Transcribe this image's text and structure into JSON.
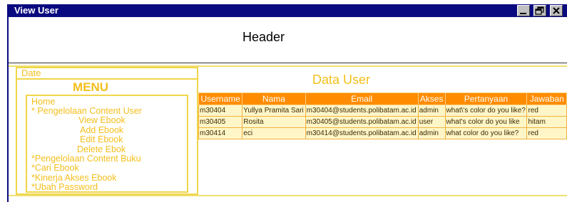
{
  "window": {
    "title": "View User"
  },
  "header": {
    "text": "Header"
  },
  "sidebar": {
    "date_label": "Date",
    "menu_title": "MENU",
    "items": [
      "Home",
      "* Pengelolaan Content User",
      "View Ebook",
      "Add Ebook",
      "Edit Ebook",
      "Delete Ebok",
      "*Pengelolaan Content Buku",
      "*Cari Ebook",
      "*Kinerja Akses Ebook",
      "*Ubah Password"
    ]
  },
  "main": {
    "title": "Data User",
    "columns": [
      "Username",
      "Nama",
      "Email",
      "Akses",
      "Pertanyaan",
      "Jawaban"
    ],
    "rows": [
      [
        "m30404",
        "Yullya Pramita Sari",
        "m30404@students.polibatam.ac.id",
        "admin",
        "what\\'s color do you like?",
        "red"
      ],
      [
        "m30405",
        "Rosita",
        "m30405@students.polibatam.ac.id",
        "user",
        "what's color do you like",
        "hitam"
      ],
      [
        "m30414",
        "eci",
        "m30414@students.polibatam.ac.id",
        "admin",
        "what color do you like?",
        "red"
      ]
    ]
  },
  "colors": {
    "titlebar": "#0a0a80",
    "accent": "#f4bf1c",
    "table_header": "#ff8c00",
    "table_row": "#fff6c8"
  },
  "icons": [
    "minimize-icon",
    "restore-icon",
    "close-icon"
  ]
}
